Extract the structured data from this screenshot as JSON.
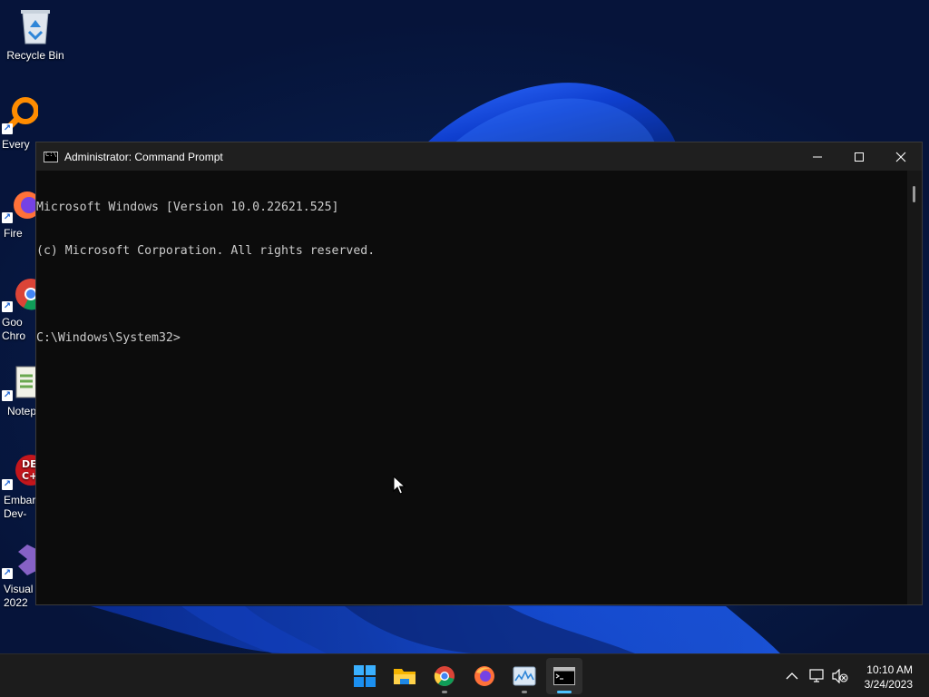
{
  "desktop": {
    "icons": [
      {
        "label": "Recycle Bin",
        "icon": "recycle-bin-icon"
      },
      {
        "label": "Every",
        "icon": "everything-search-icon"
      },
      {
        "label": "Fire",
        "icon": "firefox-icon"
      },
      {
        "label": "Goo\nChro",
        "icon": "chrome-icon"
      },
      {
        "label": "Notep",
        "icon": "notepad-plus-plus-icon"
      },
      {
        "label": "Embar\nDev-",
        "icon": "embarcadero-dev-cpp-icon"
      },
      {
        "label": "Visual\n2022",
        "icon": "visual-studio-icon"
      }
    ]
  },
  "window": {
    "title": "Administrator: Command Prompt",
    "controls": {
      "minimize": "minimize-icon",
      "maximize": "maximize-icon",
      "close": "close-icon"
    }
  },
  "console": {
    "lines": [
      "Microsoft Windows [Version 10.0.22621.525]",
      "(c) Microsoft Corporation. All rights reserved.",
      "",
      "C:\\Windows\\System32>"
    ]
  },
  "taskbar": {
    "apps": [
      {
        "name": "start",
        "icon": "windows-start-icon",
        "running": false,
        "active": false
      },
      {
        "name": "file-explorer",
        "icon": "folder-icon",
        "running": false,
        "active": false
      },
      {
        "name": "chrome",
        "icon": "chrome-icon",
        "running": true,
        "active": false
      },
      {
        "name": "firefox",
        "icon": "firefox-icon",
        "running": false,
        "active": false
      },
      {
        "name": "task-manager",
        "icon": "task-manager-icon",
        "running": true,
        "active": false
      },
      {
        "name": "command-prompt",
        "icon": "terminal-icon",
        "running": true,
        "active": true
      }
    ],
    "tray": {
      "time": "10:10 AM",
      "date": "3/24/2023",
      "icons": [
        "chevron-up-icon",
        "network-icon",
        "volume-muted-icon"
      ]
    }
  },
  "colors": {
    "console_bg": "#0c0c0c",
    "console_text": "#cccccc",
    "titlebar_bg": "#1f1f1f",
    "taskbar_bg": "#1c1c1c",
    "accent": "#4cc2ff"
  }
}
